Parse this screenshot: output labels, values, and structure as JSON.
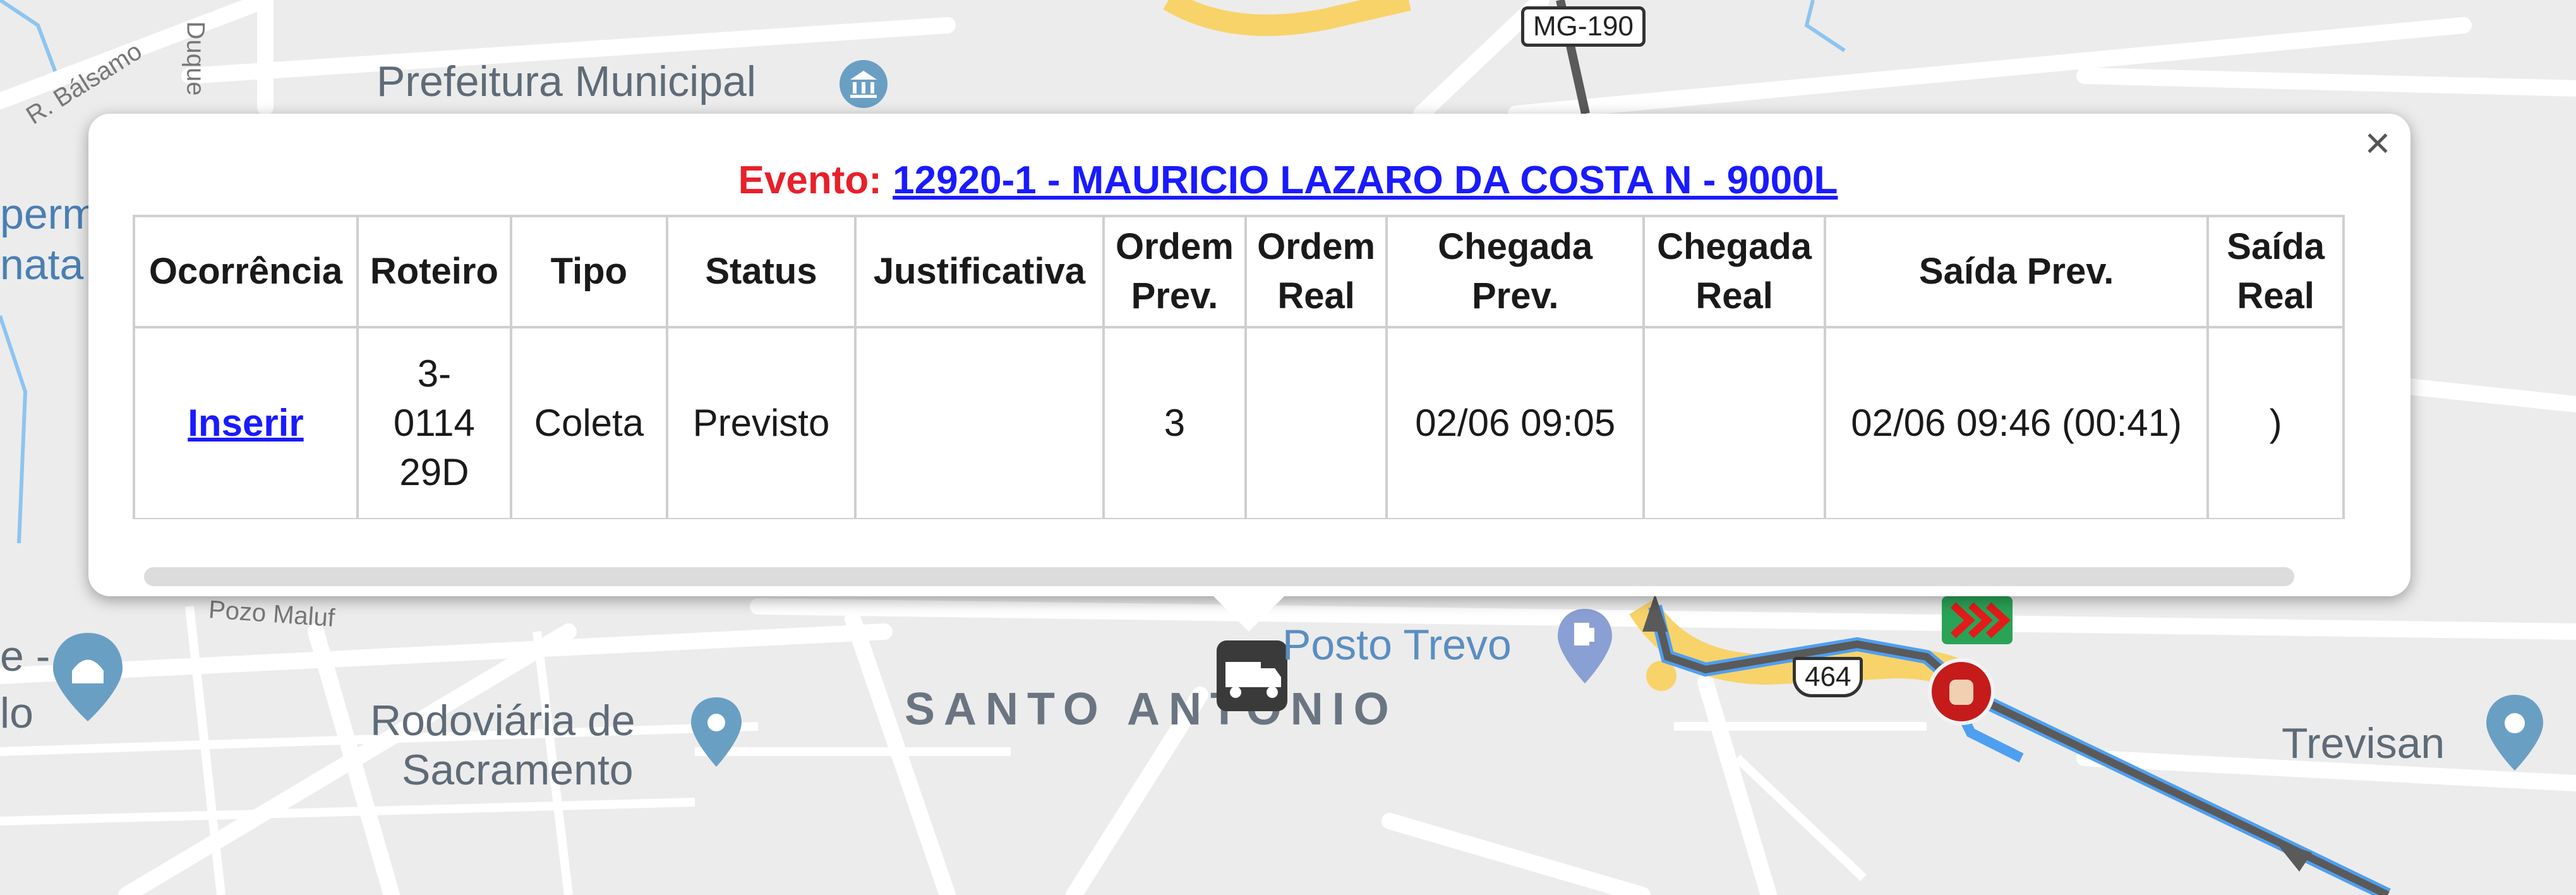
{
  "map": {
    "labels": {
      "prefeitura": "Prefeitura Municipal",
      "posto": "Posto Trevo",
      "area": "SANTO ANTONIO",
      "rodoviaria_line1": "Rodoviária de",
      "rodoviaria_line2": "Sacramento",
      "trevisan": "Trevisan",
      "street_balsamo": "R. Bálsamo",
      "street_duque": "Duque",
      "street_pozo": "Pozo Maluf",
      "street_r": "R.",
      "left_edge_1": "perm",
      "left_edge_2": "nata",
      "left_edge_3": "e -",
      "left_edge_4": "lo"
    },
    "shields": {
      "mg190": "MG-190",
      "r464": "464"
    },
    "colors": {
      "route_blue": "#4f9ff0",
      "route_gray": "#5a5a5a",
      "road_yellow": "#f8d36a",
      "poi_blue": "#6a9fc4"
    }
  },
  "popup": {
    "evento_label": "Evento:",
    "evento_link": "12920-1 - MAURICIO LAZARO DA COSTA N - 9000L",
    "close_symbol": "×",
    "headers": {
      "ocorrencia": "Ocorrência",
      "roteiro": "Roteiro",
      "tipo": "Tipo",
      "status": "Status",
      "justificativa": "Justificativa",
      "ordem_prev_1": "Ordem",
      "ordem_prev_2": "Prev.",
      "ordem_real_1": "Ordem",
      "ordem_real_2": "Real",
      "chegada_prev_1": "Chegada",
      "chegada_prev_2": "Prev.",
      "chegada_real_1": "Chegada",
      "chegada_real_2": "Real",
      "saida_prev": "Saída Prev.",
      "saida_real_1": "Saída",
      "saida_real_2": "Real"
    },
    "row": {
      "ocorrencia_link": "Inserir",
      "roteiro_1": "3-",
      "roteiro_2": "0114",
      "roteiro_3": "29D",
      "tipo": "Coleta",
      "status": "Previsto",
      "justificativa": "",
      "ordem_prev": "3",
      "ordem_real": "",
      "chegada_prev": "02/06 09:05",
      "chegada_real": "",
      "saida_prev": "02/06 09:46 (00:41)",
      "saida_real": ")"
    }
  }
}
